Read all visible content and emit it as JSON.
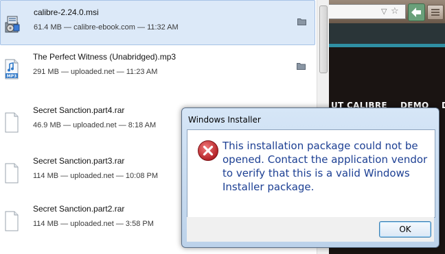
{
  "downloads": [
    {
      "name": "calibre-2.24.0.msi",
      "meta": "61.4 MB — calibre-ebook.com — 11:32 AM",
      "icon": "msi-installer-icon",
      "folder_icon": true
    },
    {
      "name": "The Perfect Witness (Unabridged).mp3",
      "meta": "291 MB — uploaded.net — 11:23 AM",
      "icon": "mp3-file-icon",
      "folder_icon": true
    },
    {
      "name": "Secret Sanction.part4.rar",
      "meta": "46.9 MB — uploaded.net — 8:18 AM",
      "icon": "generic-file-icon",
      "folder_icon": false
    },
    {
      "name": "Secret Sanction.part3.rar",
      "meta": "114 MB — uploaded.net — 10:08 PM",
      "icon": "generic-file-icon",
      "folder_icon": false
    },
    {
      "name": "Secret Sanction.part2.rar",
      "meta": "114 MB — uploaded.net — 3:58 PM",
      "icon": "generic-file-icon",
      "folder_icon": false
    }
  ],
  "browser": {
    "nav_items": [
      "UT CALIBRE",
      "DEMO",
      "D"
    ]
  },
  "dialog": {
    "title": "Windows Installer",
    "message": "This installation package could not be opened.  Contact the application vendor to verify that this is a valid Windows Installer package.",
    "ok_label": "OK",
    "icon": "error-icon"
  },
  "colors": {
    "message_text": "#1c3f93",
    "selected_row": "#dce9f8",
    "error_red": "#c8282d",
    "site_accent": "#2f8fa3"
  }
}
